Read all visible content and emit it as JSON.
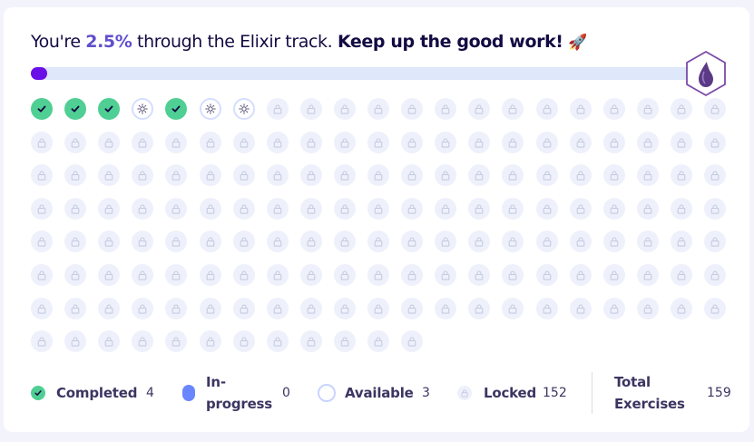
{
  "progress": {
    "prefix": "You're ",
    "percent": "2.5%",
    "middle": " through the Elixir track. ",
    "encouragement": "Keep up the good work!",
    "rocket": "🚀",
    "fraction": 0.025
  },
  "track": {
    "icon": "elixir-drop-icon"
  },
  "exercises": {
    "total": 159,
    "statuses_first_row": [
      "completed",
      "completed",
      "completed",
      "available",
      "completed",
      "available",
      "available"
    ],
    "icons": {
      "completed": "checkmark-icon",
      "available": "sun-icon",
      "locked": "lock-icon",
      "in_progress": "in-progress-dot-icon"
    }
  },
  "legend": {
    "completed_label": "Completed",
    "completed_count": "4",
    "inprogress_label_1": "In-",
    "inprogress_label_2": "progress",
    "inprogress_count": "0",
    "available_label": "Available",
    "available_count": "3",
    "locked_label": "Locked",
    "locked_count": "152",
    "total_label_1": "Total",
    "total_label_2": "Exercises",
    "total_count": "159"
  },
  "colors": {
    "completed": "#4fcf93",
    "available_border": "#d5deff",
    "locked": "#eef1fb",
    "in_progress": "#6a86ff",
    "progress_fill": "#6a0fe6",
    "progress_track": "#dfe7fb",
    "accent": "#604fcd"
  }
}
